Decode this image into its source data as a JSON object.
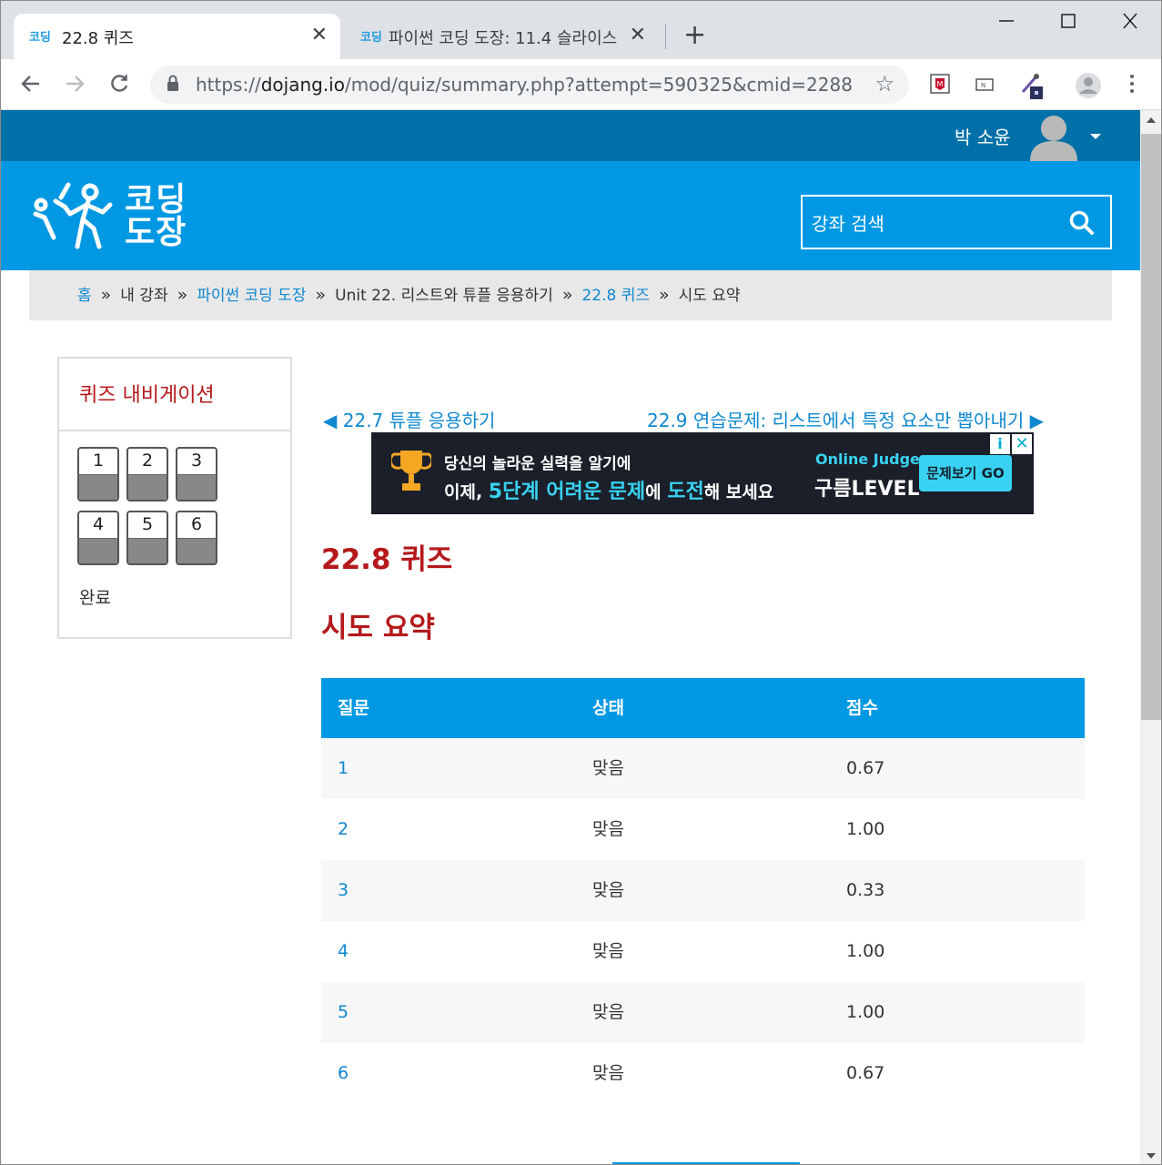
{
  "browser": {
    "tabs": [
      {
        "title": "22.8 퀴즈",
        "favicon": "코딩 도장 favicon",
        "active": true
      },
      {
        "title": "파이썬 코딩 도장: 11.4 슬라이스",
        "favicon": "코딩 도장 favicon",
        "active": false
      }
    ],
    "url_prefix": "https://",
    "url_host": "dojang.io",
    "url_path": "/mod/quiz/summary.php?attempt=590325&cmid=2288",
    "icons": [
      "back-icon",
      "forward-icon",
      "reload-icon",
      "lock-icon",
      "star-icon",
      "extension-icon",
      "profile-icon",
      "menu-icon"
    ]
  },
  "topbar": {
    "user_name": "박 소윤"
  },
  "header": {
    "logo_line1": "코딩",
    "logo_line2": "도장",
    "search_placeholder": "강좌 검색"
  },
  "breadcrumb": {
    "sep": "»",
    "items": [
      {
        "label": "홈",
        "link": true
      },
      {
        "label": "내 강좌",
        "link": false
      },
      {
        "label": "파이썬 코딩 도장",
        "link": true
      },
      {
        "label": "Unit 22. 리스트와 튜플 응용하기",
        "link": false
      },
      {
        "label": "22.8 퀴즈",
        "link": true
      },
      {
        "label": "시도 요약",
        "link": false
      }
    ]
  },
  "quiz_nav": {
    "heading": "퀴즈 내비게이션",
    "buttons": [
      "1",
      "2",
      "3",
      "4",
      "5",
      "6"
    ],
    "finish": "완료"
  },
  "pager": {
    "prev": "◀ 22.7 튜플 응용하기",
    "next": "22.9 연습문제: 리스트에서 특정 요소만 뽑아내기 ▶"
  },
  "ad": {
    "line1": "당신의 놀라운 실력을 알기에",
    "line2_a": "이제, ",
    "line2_b": "5단계 어려운 문제",
    "line2_c": "에 ",
    "line2_d": "도전",
    "line2_e": "해 보세요",
    "brand_top": "Online Judge",
    "brand": "구름LEVEL",
    "cta": "문제보기 GO",
    "info": "i",
    "close": "✕"
  },
  "main": {
    "title": "22.8 퀴즈",
    "subtitle": "시도 요약"
  },
  "summary_table": {
    "headers": [
      "질문",
      "상태",
      "점수"
    ],
    "rows": [
      [
        "1",
        "맞음",
        "0.67"
      ],
      [
        "2",
        "맞음",
        "1.00"
      ],
      [
        "3",
        "맞음",
        "0.33"
      ],
      [
        "4",
        "맞음",
        "1.00"
      ],
      [
        "5",
        "맞음",
        "1.00"
      ],
      [
        "6",
        "맞음",
        "0.67"
      ]
    ]
  },
  "colors": {
    "topbar": "#0070a8",
    "header": "#0098e3",
    "heading_red": "#b5191c",
    "link": "#0f88d0"
  }
}
